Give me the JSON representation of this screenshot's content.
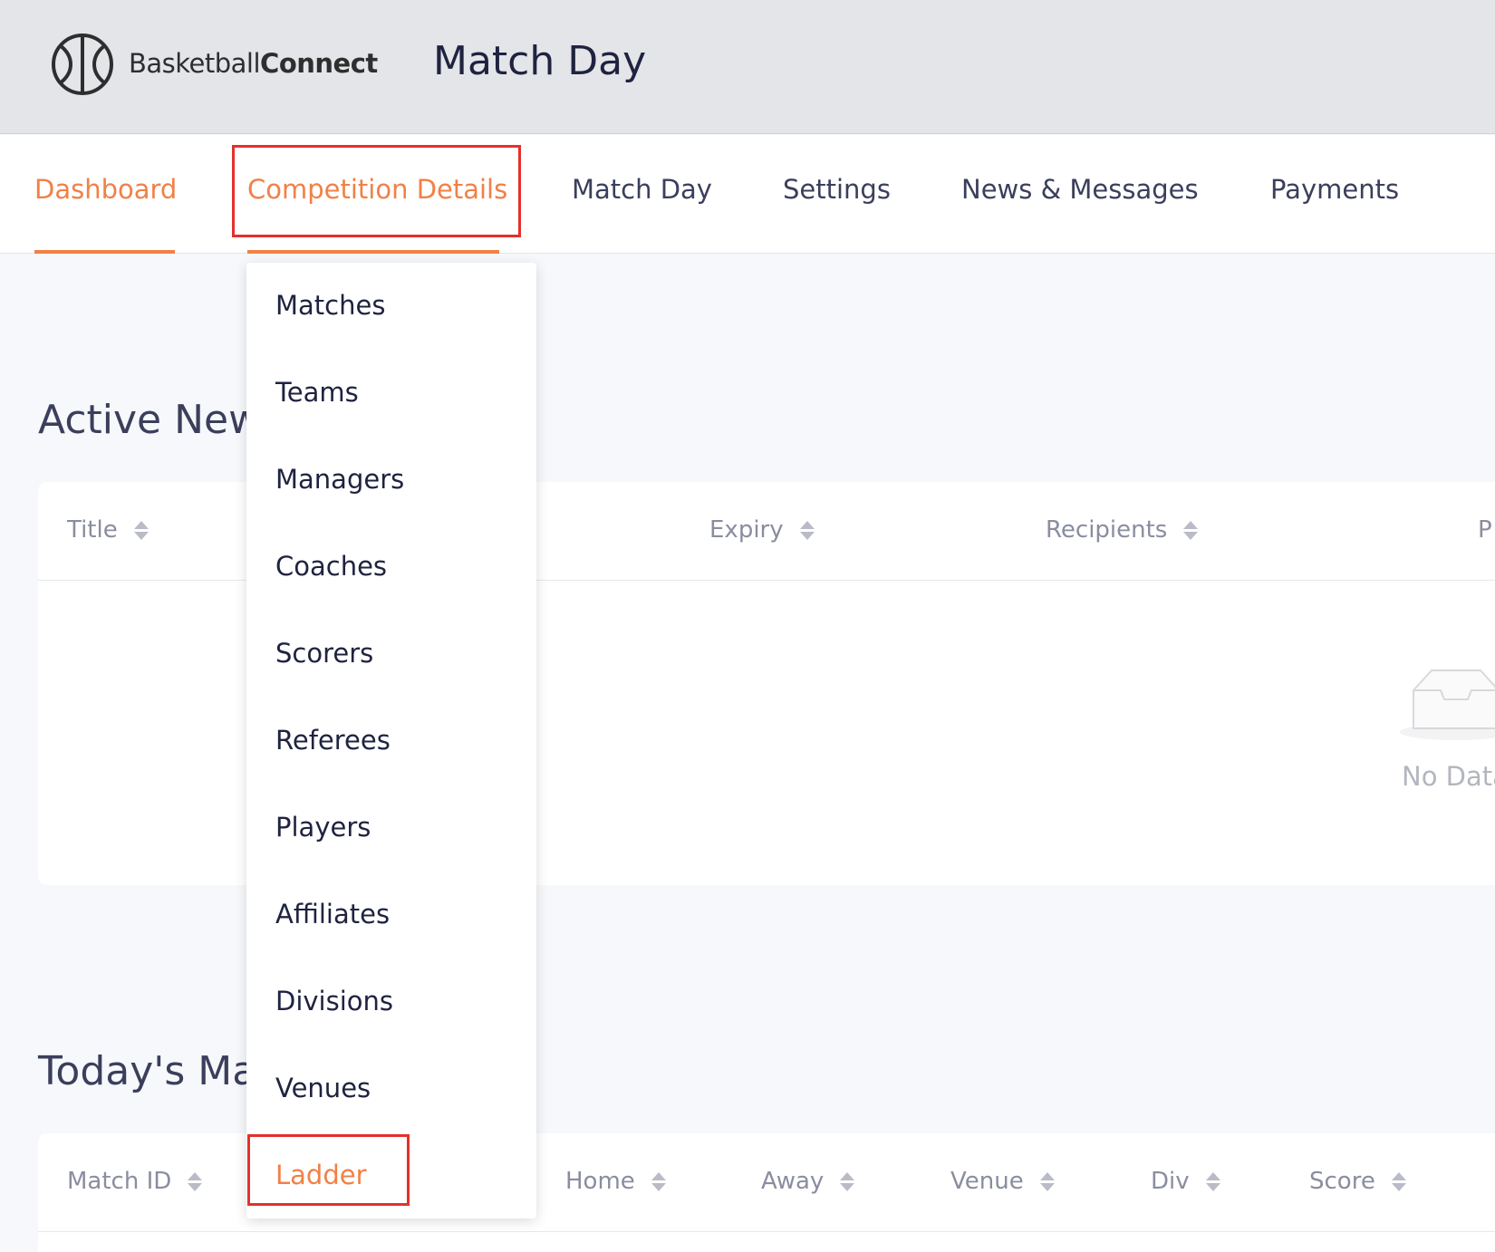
{
  "header": {
    "logo_text_light": "Basketball",
    "logo_text_bold": "Connect",
    "title": "Match Day"
  },
  "nav": {
    "items": [
      {
        "label": "Dashboard",
        "active": true
      },
      {
        "label": "Competition Details",
        "active": false,
        "highlighted": true
      },
      {
        "label": "Match Day"
      },
      {
        "label": "Settings"
      },
      {
        "label": "News & Messages"
      },
      {
        "label": "Payments"
      }
    ]
  },
  "dropdown": {
    "items": [
      {
        "label": "Matches"
      },
      {
        "label": "Teams"
      },
      {
        "label": "Managers"
      },
      {
        "label": "Coaches"
      },
      {
        "label": "Scorers"
      },
      {
        "label": "Referees"
      },
      {
        "label": "Players"
      },
      {
        "label": "Affiliates"
      },
      {
        "label": "Divisions"
      },
      {
        "label": "Venues"
      },
      {
        "label": "Ladder",
        "active": true,
        "highlighted": true
      }
    ]
  },
  "news": {
    "title": "Active New",
    "columns": [
      "Title",
      "Expiry",
      "Recipients",
      "P"
    ],
    "empty_text": "No Data"
  },
  "matches": {
    "title": "Today's Ma",
    "columns": [
      "Match ID",
      "Home",
      "Away",
      "Venue",
      "Div",
      "Score"
    ]
  },
  "colors": {
    "accent": "#f28046",
    "highlight": "#e5302c",
    "header_bg": "#e4e5e9"
  }
}
